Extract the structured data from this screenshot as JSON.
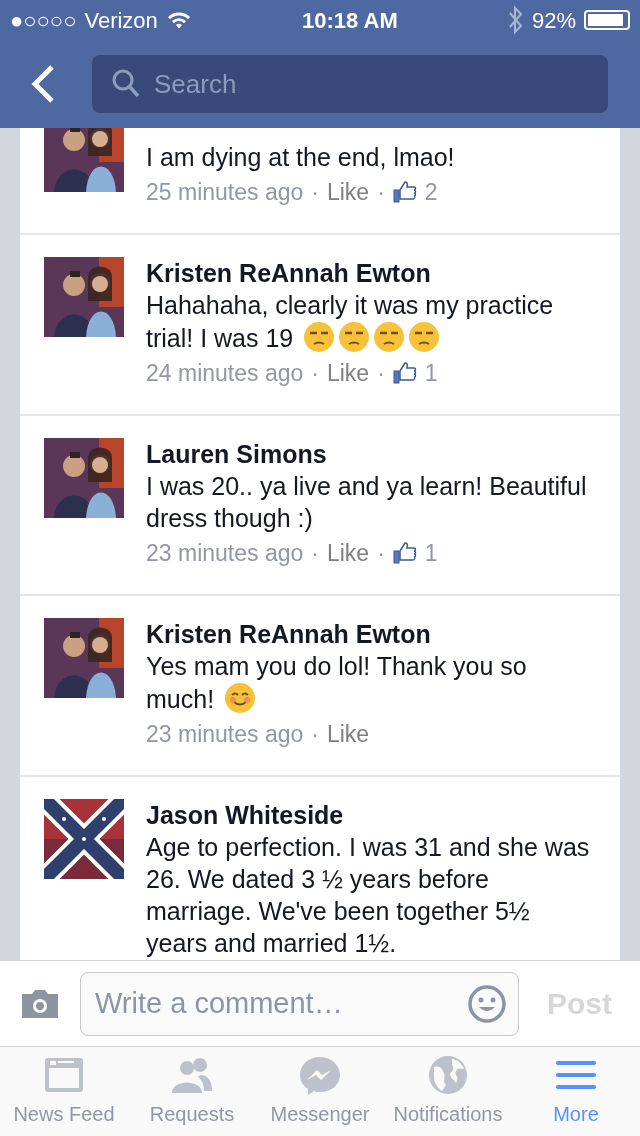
{
  "status_bar": {
    "signal_dots": "●○○○○",
    "carrier": "Verizon",
    "time": "10:18 AM",
    "battery": "92%"
  },
  "nav": {
    "search": {
      "placeholder": "Search"
    }
  },
  "comments": [
    {
      "text": "I am dying at the end, lmao!",
      "time": "25 minutes ago",
      "separator": "·",
      "like": "Like",
      "likes": "2"
    },
    {
      "name": "Kristen ReAnnah Ewton",
      "text": "Hahahaha, clearly it was my practice trial! I was 19",
      "emojis": [
        {
          "kind": "unamused"
        },
        {
          "kind": "unamused"
        },
        {
          "kind": "unamused"
        },
        {
          "kind": "unamused"
        }
      ],
      "time": "24 minutes ago",
      "separator": "·",
      "like": "Like",
      "likes": "1"
    },
    {
      "name": "Lauren Simons",
      "text": "I was 20.. ya live and ya learn! Beautiful dress though :)",
      "time": "23 minutes ago",
      "separator": "·",
      "like": "Like",
      "likes": "1"
    },
    {
      "name": "Kristen ReAnnah Ewton",
      "text": "Yes mam you do lol! Thank you so much!",
      "emojis": [
        {
          "kind": "smiling"
        }
      ],
      "time": "23 minutes ago",
      "separator": "·",
      "like": "Like"
    },
    {
      "name": "Jason Whiteside",
      "text": "Age to perfection. I was 31 and she was 26. We dated 3 ½ years before marriage. We've been together 5½ years and married 1½."
    }
  ],
  "composer": {
    "placeholder": "Write a comment…",
    "post": "Post",
    "post_disabled": true
  },
  "tabs": [
    {
      "label": "News Feed",
      "selected": false
    },
    {
      "label": "Requests",
      "selected": false
    },
    {
      "label": "Messenger",
      "selected": false
    },
    {
      "label": "Notifications",
      "selected": false
    },
    {
      "label": "More",
      "selected": true
    }
  ]
}
